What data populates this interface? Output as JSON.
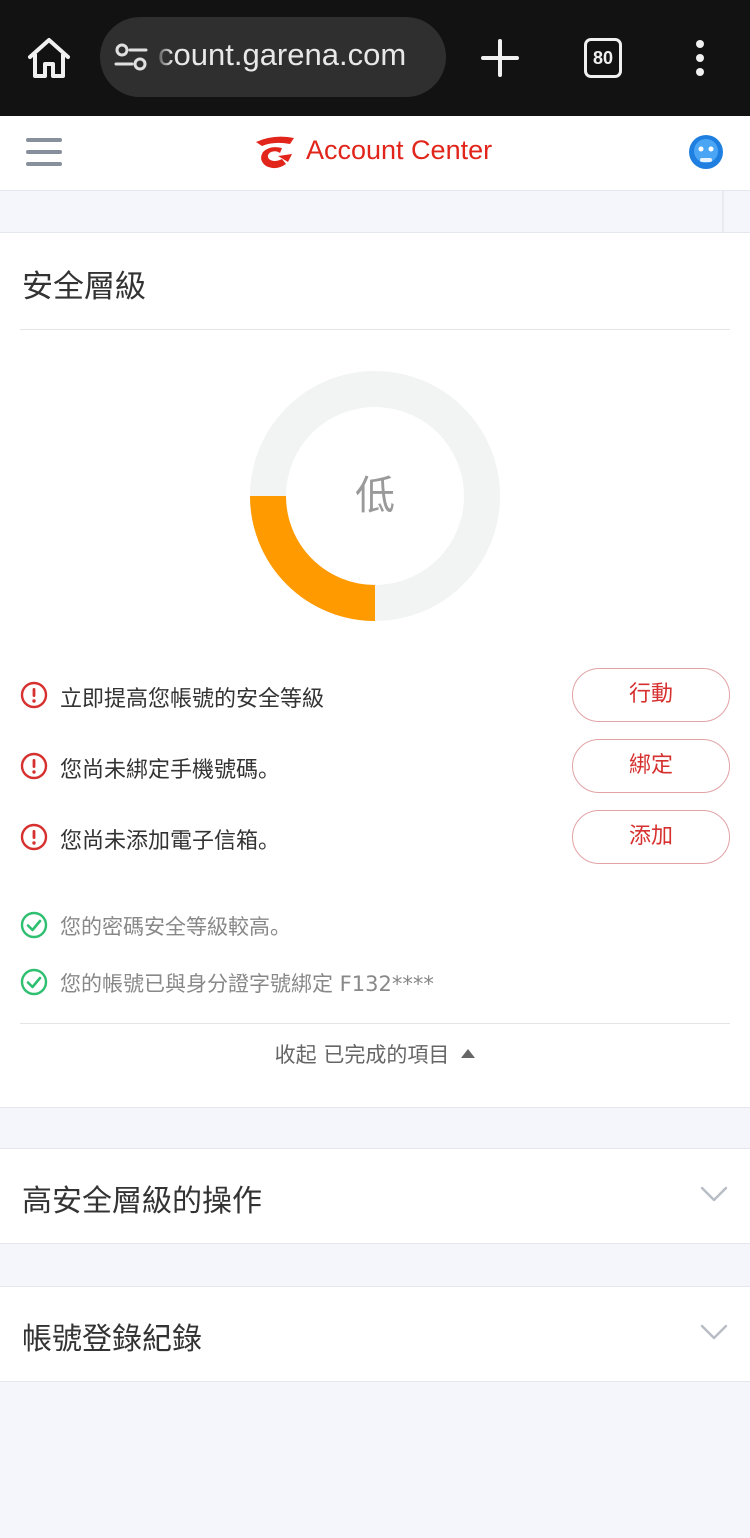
{
  "browser": {
    "url": "count.garena.com",
    "tab_count": "80"
  },
  "header": {
    "title": "Account Center"
  },
  "security": {
    "title": "安全層級",
    "level_label": "低",
    "level_fraction": 0.25,
    "gauge_color": "#ff9a00",
    "track_color": "#f1f4f3",
    "tasks": [
      {
        "text": "立即提高您帳號的安全等級",
        "button": "行動"
      },
      {
        "text": "您尚未綁定手機號碼。",
        "button": "綁定"
      },
      {
        "text": "您尚未添加電子信箱。",
        "button": "添加"
      }
    ],
    "completed": [
      {
        "text": "您的密碼安全等級較高。"
      },
      {
        "text": "您的帳號已與身分證字號綁定 F132****"
      }
    ],
    "collapse_label": "收起 已完成的項目"
  },
  "sections": [
    {
      "title": "高安全層級的操作"
    },
    {
      "title": "帳號登錄紀錄"
    }
  ],
  "colors": {
    "brand": "#e1251b",
    "warning": "#d6302f",
    "success": "#2fbf71"
  }
}
